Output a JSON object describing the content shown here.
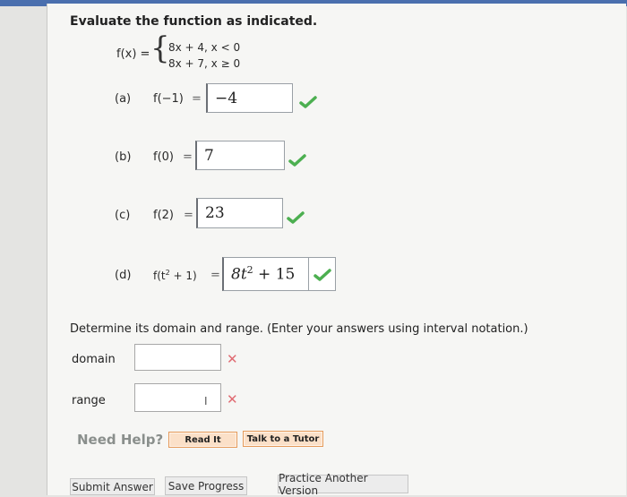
{
  "problem": {
    "title": "Evaluate the function as indicated.",
    "function_label": "f(x) =",
    "piece_1": "8x + 4, x < 0",
    "piece_2": "8x + 7, x ≥ 0"
  },
  "parts": [
    {
      "label": "(a)",
      "expr": "f(−1)",
      "eq": "=",
      "answer": "−4",
      "status": "correct"
    },
    {
      "label": "(b)",
      "expr": "f(0)",
      "eq": "=",
      "answer": "7",
      "status": "correct"
    },
    {
      "label": "(c)",
      "expr": "f(2)",
      "eq": "=",
      "answer": "23",
      "status": "correct"
    },
    {
      "label": "(d)",
      "expr_base": "f(t",
      "expr_exp": "2",
      "expr_tail": " + 1)",
      "eq": "=",
      "answer_base": "8t",
      "answer_exp": "2",
      "answer_tail": " + 15",
      "status": "correct"
    }
  ],
  "domain_range": {
    "instruction": "Determine its domain and range. (Enter your answers using interval notation.)",
    "domain_label": "domain",
    "domain_value": "",
    "domain_status": "incorrect",
    "range_label": "range",
    "range_value": "",
    "range_status": "incorrect"
  },
  "help": {
    "label": "Need Help?",
    "read_it": "Read It",
    "talk_to_tutor": "Talk to a Tutor"
  },
  "footer": {
    "submit": "Submit Answer",
    "save": "Save Progress",
    "practice": "Practice Another Version"
  },
  "colors": {
    "check": "#4caf50",
    "cross": "#e06b72",
    "accent_orange": "#e59a5a"
  },
  "icons": {
    "correct": "check-icon",
    "incorrect": "cross-icon"
  }
}
